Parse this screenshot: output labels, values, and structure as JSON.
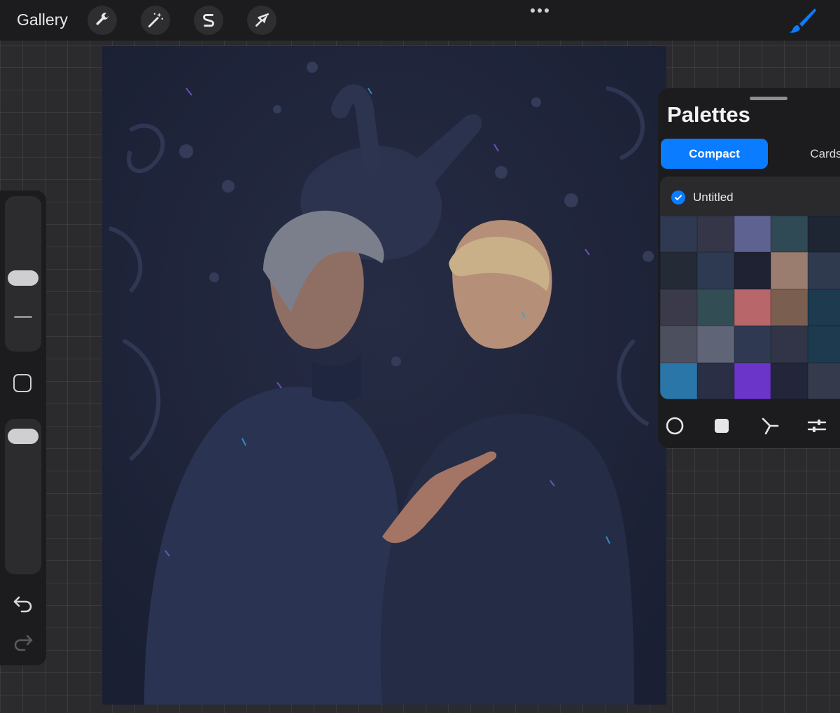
{
  "topbar": {
    "gallery_label": "Gallery",
    "tools": [
      "wrench-icon",
      "magic-wand-icon",
      "selection-icon",
      "transform-arrow-icon"
    ],
    "menu": "more-dots-icon",
    "active_tool": "brush-icon",
    "accent_color": "#0a7cff"
  },
  "panel": {
    "title": "Palettes",
    "tabs": {
      "compact": "Compact",
      "cards": "Cards"
    },
    "palette": {
      "name": "Untitled",
      "swatches": [
        "#2f3a52",
        "#353748",
        "#5e6290",
        "#2f4a55",
        "#1f2633",
        "#242a36",
        "#2e3a52",
        "#1f2233",
        "#9a7d6e",
        "#2f3a4f",
        "#3a3a4a",
        "#334d55",
        "#b8666a",
        "#7a5e50",
        "#1d3a4f",
        "#4c4f5e",
        "#5f6477",
        "#2f3a52",
        "#323548",
        "#1d3a4e",
        "#2b76a8",
        "#2b2f45",
        "#6a35c8",
        "#23263a",
        "#353a4c"
      ]
    },
    "bottom_icons": [
      "circle-icon",
      "square-icon",
      "symmetry-icon",
      "sliders-icon"
    ]
  },
  "sidebar": {
    "brush_size_level": 0.47,
    "opacity_level": 0.97,
    "icons": [
      "modify-square-icon",
      "undo-icon",
      "redo-icon"
    ]
  }
}
